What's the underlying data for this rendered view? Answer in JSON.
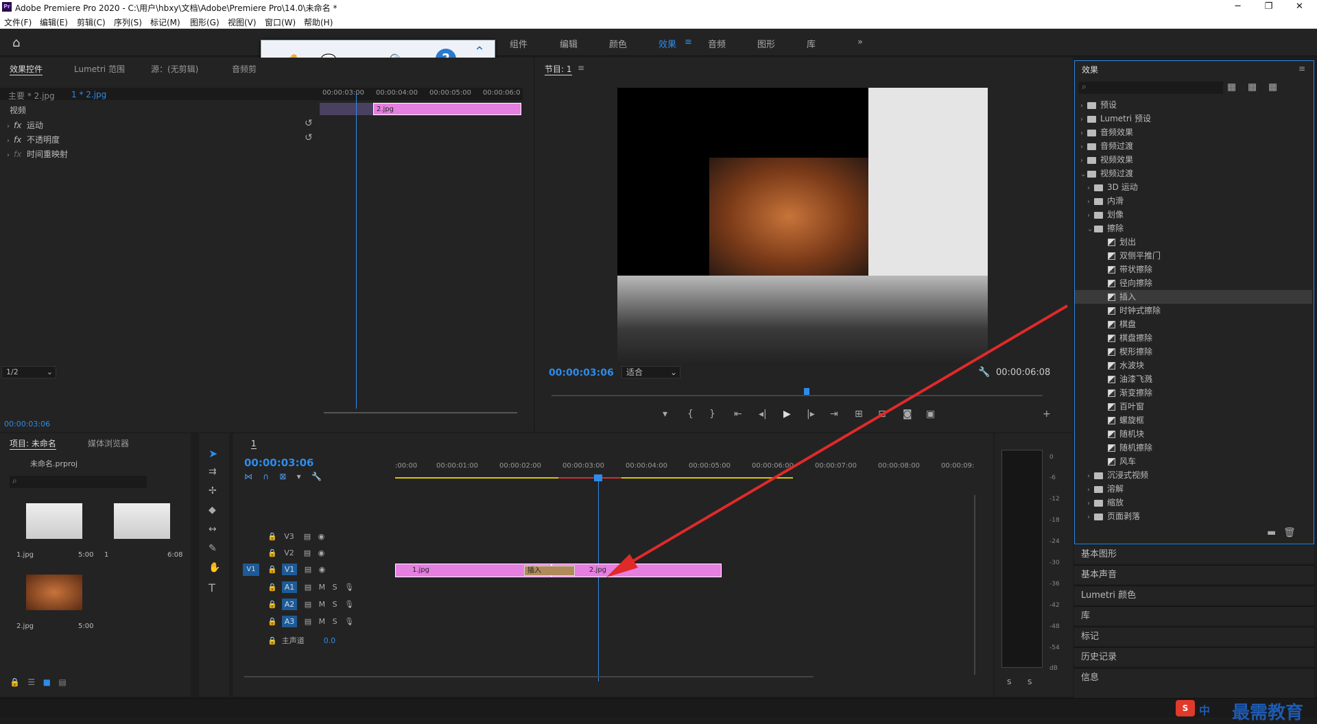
{
  "title_bar": {
    "title": "Adobe Premiere Pro 2020 - C:\\用户\\hbxy\\文档\\Adobe\\Premiere Pro\\14.0\\未命名 *",
    "minimize": "─",
    "maximize": "❐",
    "close": "✕"
  },
  "menu": [
    "文件(F)",
    "编辑(E)",
    "剪辑(C)",
    "序列(S)",
    "标记(M)",
    "图形(G)",
    "视图(V)",
    "窗口(W)",
    "帮助(H)"
  ],
  "workspaces": [
    {
      "label": "组件"
    },
    {
      "label": "编辑"
    },
    {
      "label": "颜色"
    },
    {
      "label": "效果",
      "active": true
    },
    {
      "label": "音频"
    },
    {
      "label": "图形"
    },
    {
      "label": "库"
    }
  ],
  "workspaces_more": "»",
  "float_toolbar": {
    "icons": [
      "hand-icon",
      "comment-icon",
      "export-icon",
      "search-zoom-icon",
      "help-icon",
      "collapse-icon"
    ]
  },
  "effect_controls": {
    "tabs": [
      "效果控件",
      "Lumetri 范围",
      "源：(无剪辑)",
      "音频剪"
    ],
    "master": "主要 * 2.jpg",
    "clip": "1 * 2.jpg",
    "ruler": [
      "00:00:03:00",
      "00:00:04:00",
      "00:00:05:00",
      "00:00:06:0"
    ],
    "clip_label": "2.jpg",
    "section": "视频",
    "props": [
      {
        "name": "运动"
      },
      {
        "name": "不透明度"
      },
      {
        "name": "时间重映射"
      }
    ],
    "timecode": "00:00:03:06"
  },
  "program": {
    "tab": "节目: 1",
    "timecode": "00:00:03:06",
    "fit": "适合",
    "quality": "1/2",
    "duration": "00:00:06:08"
  },
  "project": {
    "tabs": [
      "项目: 未命名",
      "媒体浏览器"
    ],
    "file": "未命名.prproj",
    "items": [
      {
        "name": "1.jpg",
        "dur": "5:00"
      },
      {
        "name": "1",
        "dur": "6:08"
      },
      {
        "name": "2.jpg",
        "dur": "5:00"
      }
    ]
  },
  "timeline": {
    "tab": "1",
    "timecode": "00:00:03:06",
    "ruler": [
      ":00:00",
      "00:00:01:00",
      "00:00:02:00",
      "00:00:03:00",
      "00:00:04:00",
      "00:00:05:00",
      "00:00:06:00",
      "00:00:07:00",
      "00:00:08:00",
      "00:00:09:"
    ],
    "tracks": {
      "v": [
        "V3",
        "V2",
        "V1"
      ],
      "a": [
        "A1",
        "A2",
        "A3"
      ]
    },
    "source_v1": "V1",
    "master": "主声道",
    "master_val": "0.0",
    "clips": [
      {
        "name": "1.jpg"
      },
      {
        "name": "2.jpg"
      }
    ],
    "transition": "插入"
  },
  "meter": {
    "scale": [
      "0",
      "-6",
      "-12",
      "-18",
      "-24",
      "-30",
      "-36",
      "-42",
      "-48",
      "-54",
      "dB"
    ],
    "solo": [
      "S",
      "S"
    ]
  },
  "effects_panel": {
    "title": "效果",
    "tree": [
      {
        "label": "预设",
        "level": 0,
        "kind": "folder"
      },
      {
        "label": "Lumetri 预设",
        "level": 0,
        "kind": "folder"
      },
      {
        "label": "音频效果",
        "level": 0,
        "kind": "folder"
      },
      {
        "label": "音频过渡",
        "level": 0,
        "kind": "folder"
      },
      {
        "label": "视频效果",
        "level": 0,
        "kind": "folder"
      },
      {
        "label": "视频过渡",
        "level": 0,
        "kind": "folder",
        "open": true
      },
      {
        "label": "3D 运动",
        "level": 1,
        "kind": "folder"
      },
      {
        "label": "内滑",
        "level": 1,
        "kind": "folder"
      },
      {
        "label": "划像",
        "level": 1,
        "kind": "folder"
      },
      {
        "label": "擦除",
        "level": 1,
        "kind": "folder",
        "open": true
      },
      {
        "label": "划出",
        "level": 2,
        "kind": "fx"
      },
      {
        "label": "双侧平推门",
        "level": 2,
        "kind": "fx"
      },
      {
        "label": "带状擦除",
        "level": 2,
        "kind": "fx"
      },
      {
        "label": "径向擦除",
        "level": 2,
        "kind": "fx"
      },
      {
        "label": "插入",
        "level": 2,
        "kind": "fx",
        "selected": true
      },
      {
        "label": "时钟式擦除",
        "level": 2,
        "kind": "fx"
      },
      {
        "label": "棋盘",
        "level": 2,
        "kind": "fx"
      },
      {
        "label": "棋盘擦除",
        "level": 2,
        "kind": "fx"
      },
      {
        "label": "楔形擦除",
        "level": 2,
        "kind": "fx"
      },
      {
        "label": "水波块",
        "level": 2,
        "kind": "fx"
      },
      {
        "label": "油漆飞溅",
        "level": 2,
        "kind": "fx"
      },
      {
        "label": "渐变擦除",
        "level": 2,
        "kind": "fx"
      },
      {
        "label": "百叶窗",
        "level": 2,
        "kind": "fx"
      },
      {
        "label": "螺旋框",
        "level": 2,
        "kind": "fx"
      },
      {
        "label": "随机块",
        "level": 2,
        "kind": "fx"
      },
      {
        "label": "随机擦除",
        "level": 2,
        "kind": "fx"
      },
      {
        "label": "风车",
        "level": 2,
        "kind": "fx"
      },
      {
        "label": "沉浸式视频",
        "level": 1,
        "kind": "folder"
      },
      {
        "label": "溶解",
        "level": 1,
        "kind": "folder"
      },
      {
        "label": "缩放",
        "level": 1,
        "kind": "folder"
      },
      {
        "label": "页面剥落",
        "level": 1,
        "kind": "folder"
      }
    ]
  },
  "right_panels": [
    "基本图形",
    "基本声音",
    "Lumetri 颜色",
    "库",
    "标记",
    "历史记录",
    "信息"
  ],
  "watermark": "最需教育",
  "ime": "中"
}
